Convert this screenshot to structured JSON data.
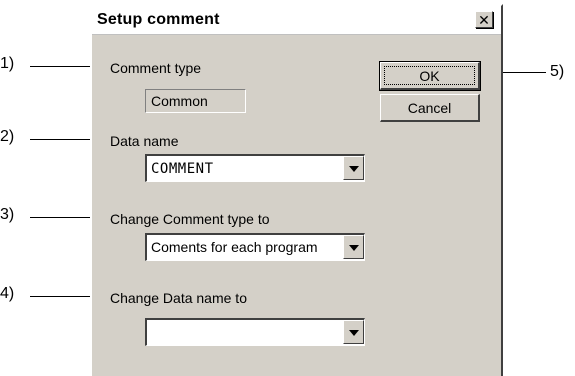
{
  "dialog": {
    "title": "Setup comment",
    "close_symbol": "✕"
  },
  "fields": {
    "comment_type_label": "Comment type",
    "comment_type_value": "Common",
    "data_name_label": "Data name",
    "data_name_value": "COMMENT",
    "change_comment_type_label": "Change Comment type to",
    "change_comment_type_value": "Coments for each program",
    "change_data_name_label": "Change Data name to",
    "change_data_name_value": ""
  },
  "buttons": {
    "ok_label": "OK",
    "cancel_label": "Cancel"
  },
  "callouts": {
    "c1": "1)",
    "c2": "2)",
    "c3": "3)",
    "c4": "4)",
    "c5": "5)"
  }
}
